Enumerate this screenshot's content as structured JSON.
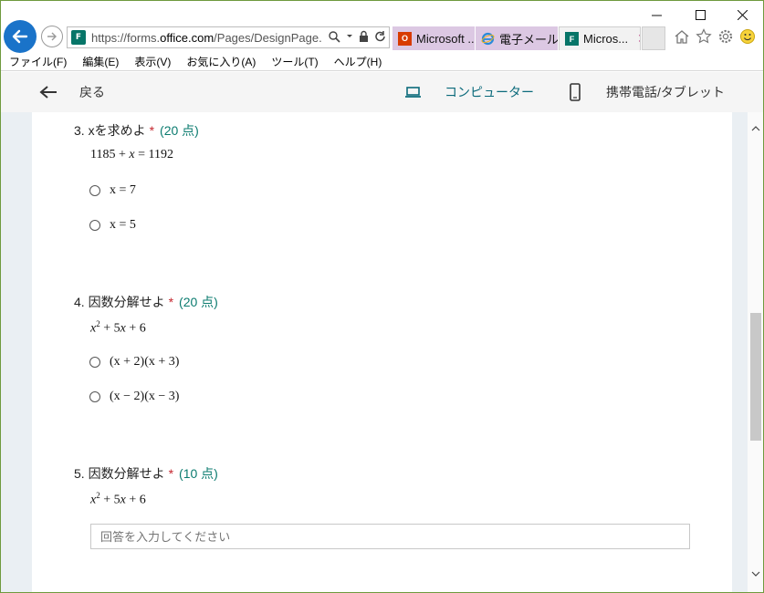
{
  "browser": {
    "url_prefix": "https://forms.",
    "url_domain": "office.com",
    "url_path": "/Pages/DesignPage.aspx",
    "tabs": [
      {
        "label": "Microsoft ..."
      },
      {
        "label": "電子メール..."
      },
      {
        "label": "Micros..."
      }
    ],
    "menu": [
      "ファイル(F)",
      "編集(E)",
      "表示(V)",
      "お気に入り(A)",
      "ツール(T)",
      "ヘルプ(H)"
    ]
  },
  "toolbar": {
    "back_label": "戻る",
    "computer_label": "コンピューター",
    "mobile_label": "携帯電話/タブレット"
  },
  "questions": [
    {
      "title": "3. xを求めよ",
      "required": "*",
      "points": "(20 点)",
      "options": [
        "x = 7",
        "x = 5"
      ]
    },
    {
      "title": "4. 因数分解せよ",
      "required": "*",
      "points": "(20 点)",
      "options": [
        "(x + 2)(x + 3)",
        "(x − 2)(x − 3)"
      ]
    },
    {
      "title": "5. 因数分解せよ",
      "required": "*",
      "points": "(10 点)",
      "answer_placeholder": "回答を入力してください"
    }
  ],
  "colors": {
    "accent_teal": "#0b7b6f",
    "required_red": "#c4262e",
    "ie_blue": "#1a73c9",
    "tab_purple": "#dcc8e3"
  }
}
